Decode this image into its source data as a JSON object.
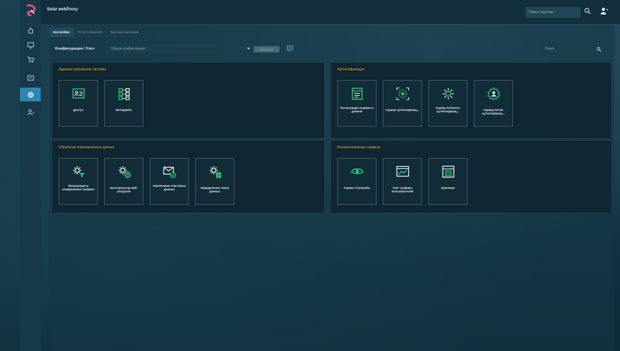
{
  "app": {
    "title": "Solar webProxy",
    "person_search_placeholder": "Поиск персоны"
  },
  "rail": {
    "items": [
      {
        "icon": "home-icon"
      },
      {
        "icon": "monitor-icon"
      },
      {
        "icon": "cart-icon"
      },
      {
        "icon": "screen-icon"
      },
      {
        "icon": "settings-globe-icon",
        "active": true
      },
      {
        "icon": "users-icon"
      }
    ]
  },
  "tabs": [
    {
      "label": "Настройки",
      "active": true
    },
    {
      "label": "Роли и сведения",
      "active": false
    },
    {
      "label": "База категоризации",
      "active": false
    }
  ],
  "toolbar": {
    "config_label": "Конфигурация / Узел",
    "config_value": "Общая конфигурация",
    "apply_label": "Применить",
    "search_placeholder": "Поиск"
  },
  "panels": {
    "admin": {
      "title": "Администрирование системы",
      "cards": [
        {
          "label": "Доступ",
          "icon": "id-card-icon"
        },
        {
          "label": "Интерфейс",
          "icon": "interface-icon"
        }
      ]
    },
    "auth": {
      "title": "Аутентификация",
      "cards": [
        {
          "label": "Регистрация сервера в домене",
          "icon": "server-register-icon"
        },
        {
          "label": "Сервер аутентификац...",
          "icon": "auth-server-icon"
        },
        {
          "label": "Сервер Kerberos-аутентификац...",
          "icon": "kerberos-icon"
        },
        {
          "label": "Сервер NTLM-аутентификац...",
          "icon": "ntlm-icon"
        }
      ]
    },
    "processing": {
      "title": "Обработка перехваченных данных",
      "cards": [
        {
          "label": "Фильтрация и кэширование трафика",
          "icon": "filter-gear-icon"
        },
        {
          "label": "Категоризатор веб-ресурсов",
          "icon": "globe-gear-icon"
        },
        {
          "label": "Извлечение текстовых данных",
          "icon": "mail-extract-icon"
        },
        {
          "label": "Определение типов данных",
          "icon": "datatype-gear-icon"
        }
      ]
    },
    "aux": {
      "title": "Вспомогательные сервисы",
      "cards": [
        {
          "label": "Сервис Cassandra",
          "icon": "eye-icon"
        },
        {
          "label": "Учет трафика пользователей",
          "icon": "traffic-chart-icon"
        },
        {
          "label": "Хранение",
          "icon": "storage-icon"
        }
      ]
    }
  },
  "colors": {
    "accent": "#2d86b4",
    "section_title": "#f0a83a",
    "icon_green": "#2ecc71"
  }
}
